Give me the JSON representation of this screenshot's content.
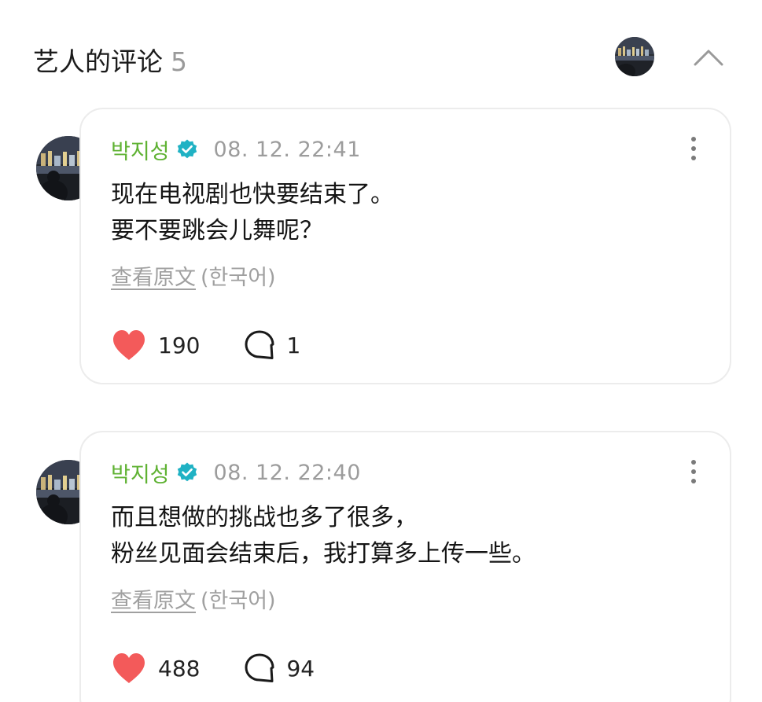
{
  "header": {
    "title": "艺人的评论",
    "count": "5"
  },
  "comments": [
    {
      "author": "박지성",
      "timestamp": "08. 12. 22:41",
      "lines": [
        "现在电视剧也快要结束了。",
        "要不要跳会儿舞呢？"
      ],
      "view_original": "查看原文",
      "language": "(한국어)",
      "likes": "190",
      "replies": "1"
    },
    {
      "author": "박지성",
      "timestamp": "08. 12. 22:40",
      "lines": [
        "而且想做的挑战也多了很多，",
        "粉丝见面会结束后，我打算多上传一些。"
      ],
      "view_original": "查看原文",
      "language": "(한국어)",
      "likes": "488",
      "replies": "94"
    }
  ],
  "colors": {
    "author": "#5fb233",
    "verified_badge": "#20b2c4",
    "heart": "#f35a5a",
    "muted_text": "#9c9c9c"
  },
  "icons": {
    "verified": "verified-badge-icon",
    "more": "more-vertical-icon",
    "like": "heart-icon",
    "reply": "speech-bubble-icon",
    "collapse": "chevron-up-icon"
  }
}
